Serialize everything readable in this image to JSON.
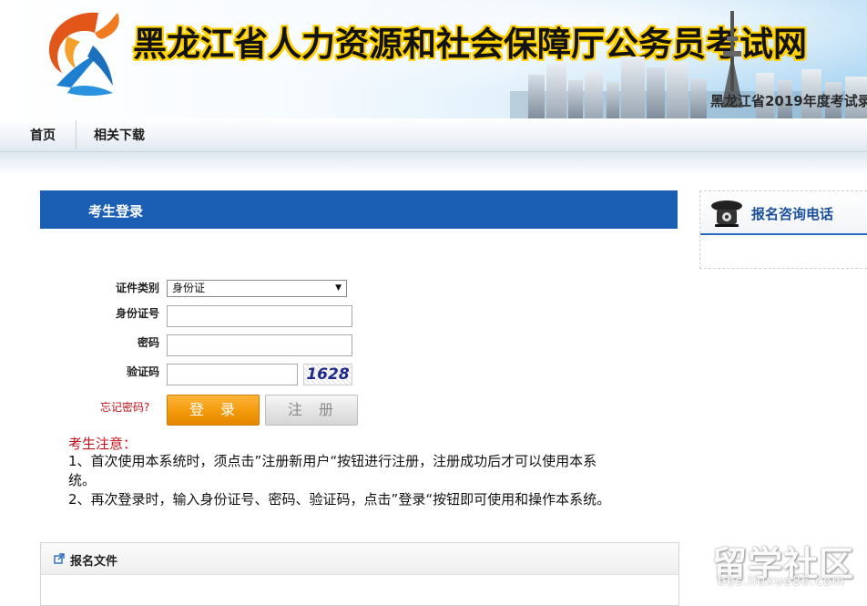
{
  "header": {
    "site_title": "黑龙江省人力资源和社会保障厅公务员考试网",
    "marquee": "黑龙江省2019年度考试录"
  },
  "nav": {
    "items": [
      {
        "label": "首页"
      },
      {
        "label": "相关下载"
      }
    ]
  },
  "login": {
    "title": "考生登录",
    "id_type_label": "证件类别",
    "id_type_selected": "身份证",
    "id_number_label": "身份证号",
    "password_label": "密码",
    "captcha_label": "验证码",
    "captcha_text": "1628",
    "forgot_password": "忘记密码?",
    "login_button": "登录",
    "register_button": "注册"
  },
  "notice": {
    "title": "考生注意：",
    "line1a": "1、首次使用本系统时，须点击”注册新用户“按钮进行注册，注册成功后才可以使用本系",
    "line1b": "统。",
    "line2": "2、再次登录时，输入身份证号、密码、验证码，点击”登录“按钮即可使用和操作本系统。"
  },
  "sidebar": {
    "hotline_title": "报名咨询电话"
  },
  "files": {
    "title": "报名文件"
  },
  "watermark": {
    "main": "留学社区",
    "sub": "bbs.liuxue86.com"
  },
  "colors": {
    "primary_blue": "#1a5fb4",
    "accent_orange": "#f39a0b",
    "alert_red": "#c0121b"
  }
}
